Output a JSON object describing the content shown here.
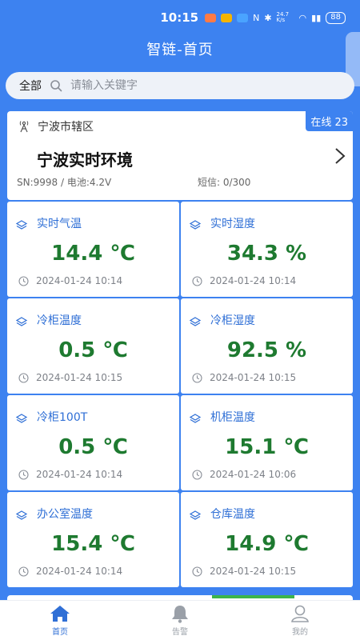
{
  "status_bar": {
    "time": "10:15",
    "battery": "88",
    "net_speed": "24.7 K/s"
  },
  "header": {
    "title": "智链-首页"
  },
  "search": {
    "scope": "全部",
    "placeholder": "请输入关键字"
  },
  "device": {
    "region": "宁波市辖区",
    "online_badge": "在线 23",
    "name": "宁波实时环境",
    "meta": "SN:9998 / 电池:4.2V",
    "sms": "短信: 0/300"
  },
  "tiles": [
    {
      "title": "实时气温",
      "value": "14.4 ℃",
      "time": "2024-01-24 10:14"
    },
    {
      "title": "实时湿度",
      "value": "34.3 %",
      "time": "2024-01-24 10:14"
    },
    {
      "title": "冷柜温度",
      "value": "0.5 ℃",
      "time": "2024-01-24 10:15"
    },
    {
      "title": "冷柜湿度",
      "value": "92.5 %",
      "time": "2024-01-24 10:15"
    },
    {
      "title": "冷柜100T",
      "value": "0.5 ℃",
      "time": "2024-01-24 10:14"
    },
    {
      "title": "机柜温度",
      "value": "15.1 ℃",
      "time": "2024-01-24 10:06"
    },
    {
      "title": "办公室温度",
      "value": "15.4 ℃",
      "time": "2024-01-24 10:14"
    },
    {
      "title": "仓库温度",
      "value": "14.9 ℃",
      "time": "2024-01-24 10:15"
    }
  ],
  "bottom_nav": [
    {
      "label": "首页",
      "icon": "home-icon",
      "active": true
    },
    {
      "label": "告警",
      "icon": "bell-icon",
      "active": false
    },
    {
      "label": "我的",
      "icon": "user-icon",
      "active": false
    }
  ],
  "colors": {
    "accent": "#3d82f0",
    "value_green": "#1e7a30",
    "tile_title_blue": "#2f6fd6"
  }
}
